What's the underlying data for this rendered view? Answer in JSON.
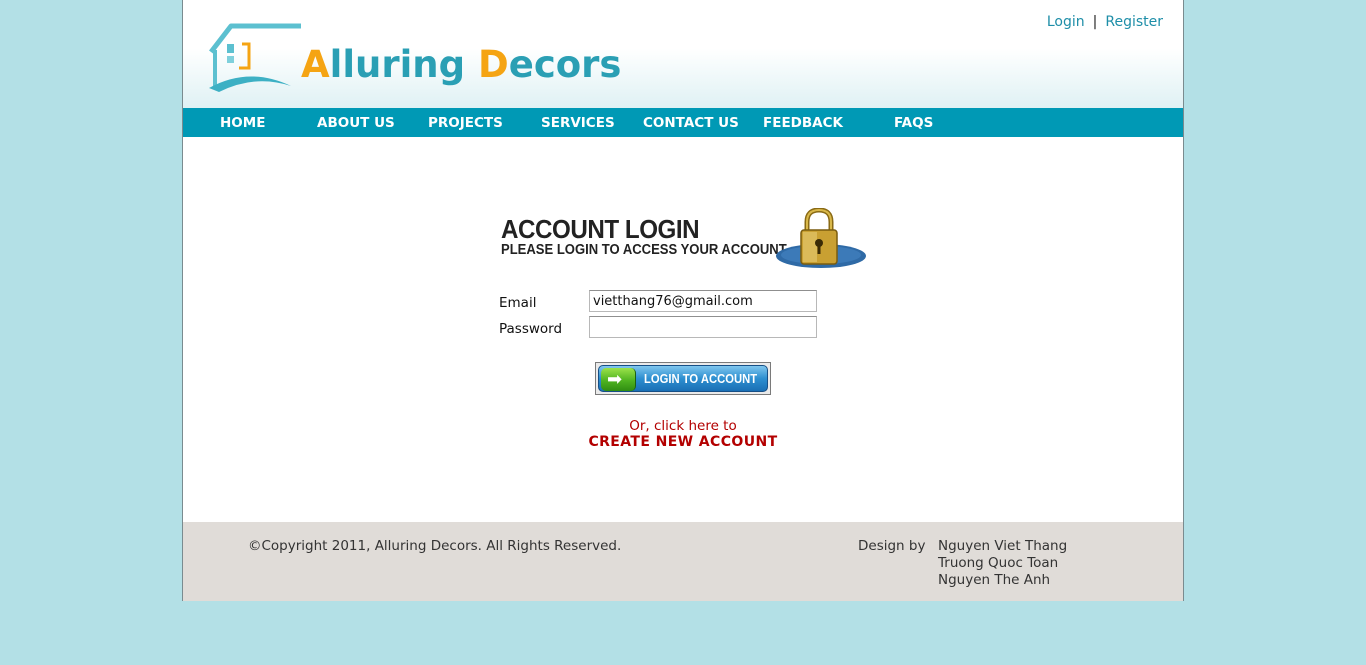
{
  "header": {
    "logo_first_cap": "A",
    "logo_first_rest": "lluring",
    "logo_second_cap": "D",
    "logo_second_rest": "ecors",
    "auth_links": {
      "login": "Login",
      "separator": "|",
      "register": "Register"
    }
  },
  "nav": {
    "items": [
      {
        "label": "HOME"
      },
      {
        "label": "ABOUT US"
      },
      {
        "label": "PROJECTS"
      },
      {
        "label": "SERVICES"
      },
      {
        "label": "CONTACT US"
      },
      {
        "label": "FEEDBACK"
      },
      {
        "label": "FAQS"
      }
    ]
  },
  "login": {
    "title": "ACCOUNT LOGIN",
    "subtitle": "PLEASE LOGIN TO ACCESS YOUR ACCOUNT",
    "email_label": "Email",
    "email_value": "vietthang76@gmail.com",
    "password_label": "Password",
    "password_value": "",
    "button_label": "LOGIN TO ACCOUNT",
    "alt_text": "Or, click here to",
    "create_link": "CREATE NEW ACCOUNT"
  },
  "footer": {
    "copyright": "©Copyright 2011, Alluring Decors. All Rights Reserved.",
    "design_label": "Design by",
    "designers": [
      "Nguyen Viet Thang",
      "Truong Quoc Toan",
      "Nguyen The Anh"
    ]
  },
  "colors": {
    "page_background": "#b3e0e6",
    "nav_background": "#0099b5",
    "logo_primary": "#2a9fb4",
    "logo_accent": "#f5a413",
    "link_red": "#b30000",
    "footer_background": "#e0dcd8"
  },
  "icons": {
    "logo_mark": "house-icon",
    "lock": "padlock-icon",
    "login_arrow": "arrow-right-icon"
  }
}
